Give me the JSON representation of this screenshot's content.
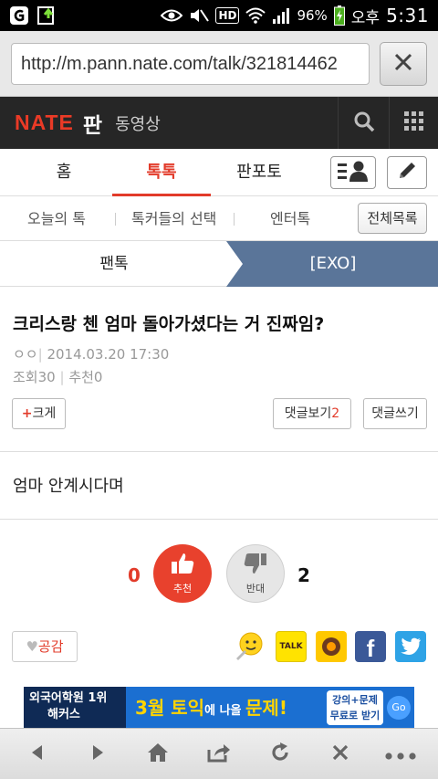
{
  "status_bar": {
    "battery": "96%",
    "ampm": "오후",
    "time": "5:31",
    "hd": "HD",
    "icons": [
      "carrier-g-icon",
      "upload-notification-icon",
      "eye-icon",
      "mute-icon",
      "hd-icon",
      "wifi-icon",
      "signal-icon",
      "battery-icon"
    ]
  },
  "browser": {
    "url": "http://m.pann.nate.com/talk/321814462"
  },
  "site_header": {
    "logo": "NATE",
    "section": "판",
    "video_link": "동영상"
  },
  "main_tabs": [
    {
      "label": "홈"
    },
    {
      "label": "톡톡"
    },
    {
      "label": "판포토"
    }
  ],
  "sub_tabs": [
    {
      "label": "오늘의 톡"
    },
    {
      "label": "톡커들의 선택"
    },
    {
      "label": "엔터톡"
    }
  ],
  "all_list_button": "전체목록",
  "breadcrumb": {
    "parent": "팬톡",
    "current": "[EXO]"
  },
  "post": {
    "title": "크리스랑 첸 엄마 돌아가셨다는 거 진짜임?",
    "author": "ㅇㅇ",
    "date": "2014.03.20 17:30",
    "views": "조회30",
    "recommends": "추천0",
    "body": "엄마 안계시다며"
  },
  "post_buttons": {
    "enlarge_plus": "+",
    "enlarge": "크게",
    "view_comments": "댓글보기",
    "comment_count": "2",
    "write_comment": "댓글쓰기"
  },
  "votes": {
    "up_count": "0",
    "up_label": "추천",
    "down_label": "반대",
    "down_count": "2"
  },
  "like_button": "공감",
  "share_icons": [
    "emoticon-icon",
    "kakaotalk-icon",
    "kakaostory-icon",
    "facebook-icon",
    "twitter-icon"
  ],
  "kakao_talk_text": "TALK",
  "ad": {
    "left_line1": "외국어학원 1위",
    "left_line2": "해커스",
    "headline_a": "3월 ",
    "headline_b": "토익",
    "headline_c": "에 나올 ",
    "headline_d": "문제!",
    "right_line1": "강의+문제",
    "right_line2": "무료로 받기",
    "go": "Go"
  },
  "bottom_nav": [
    "back-icon",
    "forward-icon",
    "home-icon",
    "share-icon",
    "refresh-icon",
    "close-icon",
    "more-icon"
  ],
  "colors": {
    "accent": "#e23b2a",
    "header_bg": "#262626",
    "breadcrumb_active": "#5a7599"
  }
}
